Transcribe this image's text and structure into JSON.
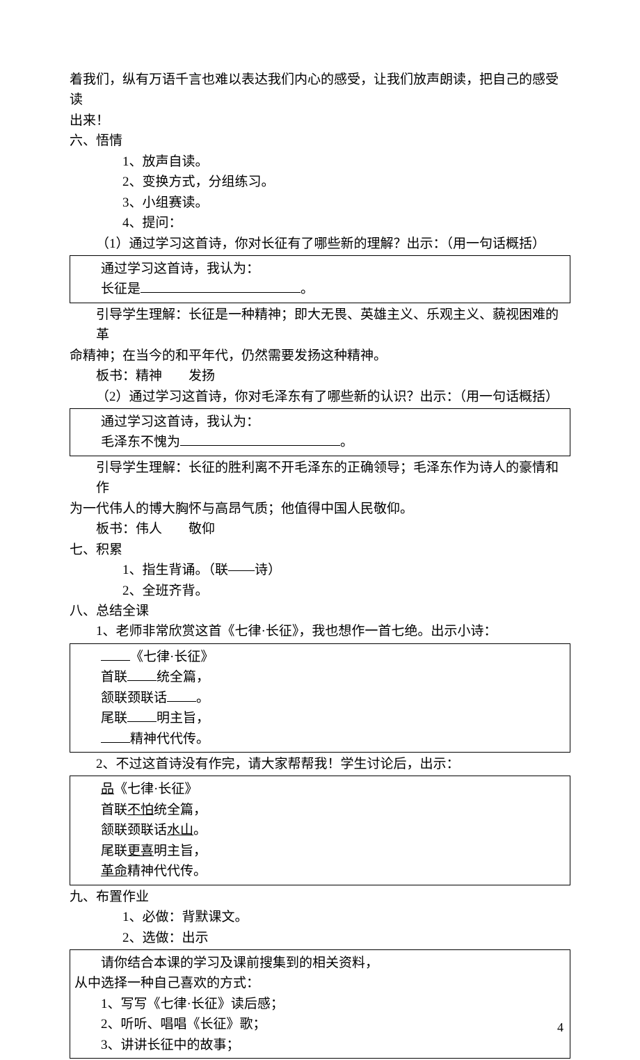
{
  "intro": {
    "l1": "着我们，纵有万语千言也难以表达我们内心的感受，让我们放声朗读，把自己的感受读",
    "l2": "出来！"
  },
  "s6": {
    "title": "六、悟情",
    "i1": "1、放声自读。",
    "i2": "2、变换方式，分组练习。",
    "i3": "3、小组赛读。",
    "i4": "4、提问：",
    "q1": "（1）通过学习这首诗，你对长征有了哪些新的理解？出示：（用一句话概括）",
    "box1a": "通过学习这首诗，我认为：",
    "box1b_pre": "长征是",
    "box1b_post": "。",
    "g1a": "引导学生理解：长征是一种精神；即大无畏、英雄主义、乐观主义、藐视困难的革",
    "g1b": "命精神；在当今的和平年代，仍然需要发扬这种精神。",
    "bs1_label": "板书：",
    "bs1_a": "精神",
    "bs1_b": "发扬",
    "q2": "（2）通过学习这首诗，你对毛泽东有了哪些新的认识？出示：（用一句话概括）",
    "box2a": "通过学习这首诗，我认为：",
    "box2b_pre": "毛泽东不愧为",
    "box2b_post": "。",
    "g2a": "引导学生理解：长征的胜利离不开毛泽东的正确领导；毛泽东作为诗人的豪情和作",
    "g2b": "为一代伟人的博大胸怀与高昂气质；他值得中国人民敬仰。",
    "bs2_label": "板书：",
    "bs2_a": "伟人",
    "bs2_b": "敬仰"
  },
  "s7": {
    "title": "七、积累",
    "i1": "1、指生背诵。（联——诗）",
    "i2": "2、全班齐背。"
  },
  "s8": {
    "title": "八、总结全课",
    "i1": "1、老师非常欣赏这首《七律·长征》，我也想作一首七绝。出示小诗：",
    "p1_sub": "《七律·长征》",
    "p1_l1a": "首联",
    "p1_l1b": "统全篇，",
    "p1_l2a": "颔联颈联话",
    "p1_l2b": "。",
    "p1_l3a": "尾联",
    "p1_l3b": "明主旨，",
    "p1_l4a": "",
    "p1_l4b": "精神代代传。",
    "i2": "2、不过这首诗没有作完，请大家帮帮我！学生讨论后，出示：",
    "p2_l0a": "品",
    "p2_l0b": "《七律·长征》",
    "p2_l1a": "首联",
    "p2_l1u": "不怕",
    "p2_l1b": "统全篇，",
    "p2_l2a": "颔联颈联话",
    "p2_l2u": "水山",
    "p2_l2b": "。",
    "p2_l3a": "尾联",
    "p2_l3u": "更喜",
    "p2_l3b": "明主旨，",
    "p2_l4u": "革命",
    "p2_l4b": "精神代代传。"
  },
  "s9": {
    "title": "九、布置作业",
    "i1": "1、必做：背默课文。",
    "i2": "2、选做：出示",
    "bx1": "请你结合本课的学习及课前搜集到的相关资料，",
    "bx2": "从中选择一种自己喜欢的方式：",
    "bx3": "1、写写《七律·长征》读后感；",
    "bx4": "2、听听、唱唱《长征》歌；",
    "bx5": "3、讲讲长征中的故事；"
  },
  "page_number": "4"
}
